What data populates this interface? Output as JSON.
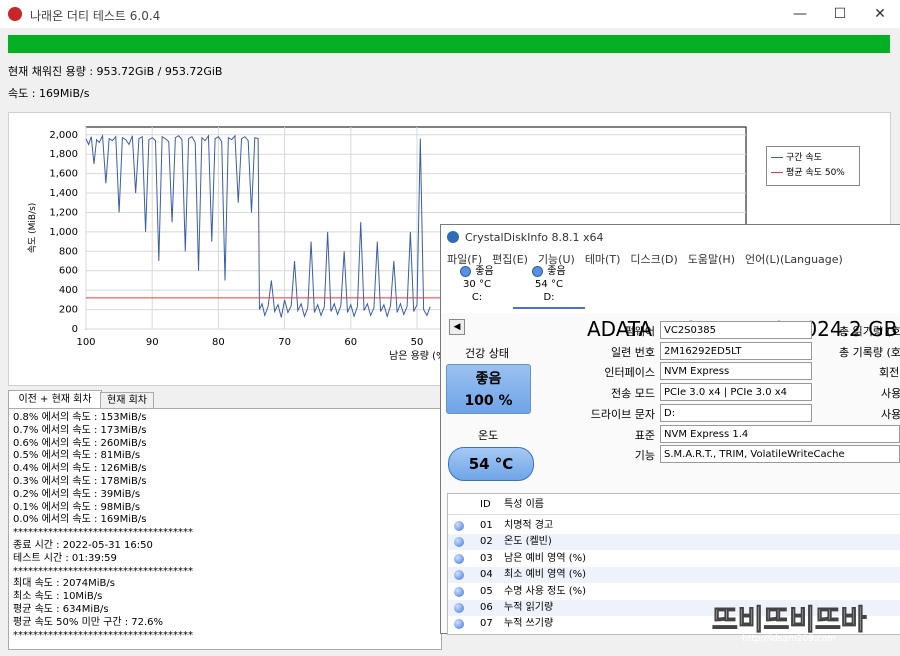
{
  "window": {
    "title": "나래온 더티 테스트 6.0.4",
    "min": "—",
    "max": "☐",
    "close": "✕"
  },
  "status": {
    "fill_label": "현재 채워진 용량 : 953.72GiB / 953.72GiB",
    "speed_label": "속도 : 169MiB/s",
    "progress": 1.0,
    "progress_color": "#06b025"
  },
  "chart_data": {
    "type": "line",
    "ylabel": "속도 (MiB/s)",
    "xlabel": "남은 용량 (%",
    "y_ticks": [
      "2,000",
      "1,800",
      "1,600",
      "1,400",
      "1,200",
      "1,000",
      "800",
      "600",
      "400",
      "200",
      "0"
    ],
    "x_ticks": [
      "100",
      "90",
      "80",
      "70",
      "60",
      "50"
    ],
    "ylim": [
      0,
      2080
    ],
    "xlim": [
      100,
      0
    ],
    "legend": {
      "series": "구간 속도",
      "average": "평균 속도 50%"
    },
    "average_value": 320,
    "series_color": "#3a5ea8",
    "average_color": "#e53b3b",
    "series": [
      {
        "x": 100,
        "y": 1960
      },
      {
        "x": 99.6,
        "y": 1900
      },
      {
        "x": 99.2,
        "y": 1980
      },
      {
        "x": 98.8,
        "y": 1700
      },
      {
        "x": 98.4,
        "y": 1950
      },
      {
        "x": 98,
        "y": 1920
      },
      {
        "x": 97.5,
        "y": 1990
      },
      {
        "x": 97,
        "y": 1500
      },
      {
        "x": 96.5,
        "y": 1960
      },
      {
        "x": 96,
        "y": 1940
      },
      {
        "x": 95.5,
        "y": 1980
      },
      {
        "x": 95,
        "y": 1200
      },
      {
        "x": 94.5,
        "y": 1970
      },
      {
        "x": 94,
        "y": 1950
      },
      {
        "x": 93.5,
        "y": 1900
      },
      {
        "x": 93,
        "y": 1990
      },
      {
        "x": 92.5,
        "y": 1400
      },
      {
        "x": 92,
        "y": 1960
      },
      {
        "x": 91.5,
        "y": 1980
      },
      {
        "x": 91,
        "y": 1000
      },
      {
        "x": 90.5,
        "y": 1950
      },
      {
        "x": 90,
        "y": 1970
      },
      {
        "x": 89.5,
        "y": 1940
      },
      {
        "x": 89,
        "y": 700
      },
      {
        "x": 88.5,
        "y": 1980
      },
      {
        "x": 88,
        "y": 1960
      },
      {
        "x": 87.5,
        "y": 1930
      },
      {
        "x": 87,
        "y": 1100
      },
      {
        "x": 86.5,
        "y": 1970
      },
      {
        "x": 86,
        "y": 1990
      },
      {
        "x": 85.5,
        "y": 1950
      },
      {
        "x": 85,
        "y": 800
      },
      {
        "x": 84.5,
        "y": 1960
      },
      {
        "x": 84,
        "y": 1980
      },
      {
        "x": 83.5,
        "y": 1920
      },
      {
        "x": 83,
        "y": 600
      },
      {
        "x": 82.5,
        "y": 1970
      },
      {
        "x": 82,
        "y": 1940
      },
      {
        "x": 81.5,
        "y": 1990
      },
      {
        "x": 81,
        "y": 900
      },
      {
        "x": 80.5,
        "y": 1960
      },
      {
        "x": 80,
        "y": 1980
      },
      {
        "x": 79.5,
        "y": 1930
      },
      {
        "x": 79,
        "y": 500
      },
      {
        "x": 78.5,
        "y": 1970
      },
      {
        "x": 78,
        "y": 1950
      },
      {
        "x": 77.5,
        "y": 1990
      },
      {
        "x": 77,
        "y": 1300
      },
      {
        "x": 76.5,
        "y": 1960
      },
      {
        "x": 76,
        "y": 1980
      },
      {
        "x": 75.5,
        "y": 1940
      },
      {
        "x": 75,
        "y": 1200
      },
      {
        "x": 74.5,
        "y": 1970
      },
      {
        "x": 74,
        "y": 1960
      },
      {
        "x": 73.8,
        "y": 200
      },
      {
        "x": 73.4,
        "y": 260
      },
      {
        "x": 73,
        "y": 140
      },
      {
        "x": 72.5,
        "y": 230
      },
      {
        "x": 72,
        "y": 500
      },
      {
        "x": 71.5,
        "y": 180
      },
      {
        "x": 71,
        "y": 250
      },
      {
        "x": 70.5,
        "y": 120
      },
      {
        "x": 70,
        "y": 300
      },
      {
        "x": 69.5,
        "y": 170
      },
      {
        "x": 69,
        "y": 240
      },
      {
        "x": 68.5,
        "y": 700
      },
      {
        "x": 68,
        "y": 190
      },
      {
        "x": 67.5,
        "y": 260
      },
      {
        "x": 67,
        "y": 130
      },
      {
        "x": 66.5,
        "y": 220
      },
      {
        "x": 66,
        "y": 900
      },
      {
        "x": 65.5,
        "y": 170
      },
      {
        "x": 65,
        "y": 250
      },
      {
        "x": 64.5,
        "y": 140
      },
      {
        "x": 64,
        "y": 230
      },
      {
        "x": 63.5,
        "y": 1000
      },
      {
        "x": 63,
        "y": 180
      },
      {
        "x": 62.5,
        "y": 260
      },
      {
        "x": 62,
        "y": 150
      },
      {
        "x": 61.5,
        "y": 240
      },
      {
        "x": 61,
        "y": 800
      },
      {
        "x": 60.5,
        "y": 170
      },
      {
        "x": 60,
        "y": 250
      },
      {
        "x": 59.5,
        "y": 130
      },
      {
        "x": 59,
        "y": 230
      },
      {
        "x": 58.5,
        "y": 1100
      },
      {
        "x": 58,
        "y": 190
      },
      {
        "x": 57.5,
        "y": 260
      },
      {
        "x": 57,
        "y": 140
      },
      {
        "x": 56.5,
        "y": 220
      },
      {
        "x": 56,
        "y": 900
      },
      {
        "x": 55.5,
        "y": 180
      },
      {
        "x": 55,
        "y": 250
      },
      {
        "x": 54.5,
        "y": 130
      },
      {
        "x": 54,
        "y": 240
      },
      {
        "x": 53.5,
        "y": 700
      },
      {
        "x": 53,
        "y": 170
      },
      {
        "x": 52.5,
        "y": 260
      },
      {
        "x": 52,
        "y": 150
      },
      {
        "x": 51.5,
        "y": 230
      },
      {
        "x": 51,
        "y": 1000
      },
      {
        "x": 50.5,
        "y": 180
      },
      {
        "x": 50,
        "y": 250
      },
      {
        "x": 49.5,
        "y": 1960
      },
      {
        "x": 49,
        "y": 200
      },
      {
        "x": 48.5,
        "y": 140
      },
      {
        "x": 48,
        "y": 230
      }
    ]
  },
  "tabs": {
    "active": "이전 + 현재 회차",
    "inactive": "현재 회차"
  },
  "log_lines": [
    "0.8% 에서의 속도 : 153MiB/s",
    "0.7% 에서의 속도 : 173MiB/s",
    "0.6% 에서의 속도 : 260MiB/s",
    "0.5% 에서의 속도 : 81MiB/s",
    "0.4% 에서의 속도 : 126MiB/s",
    "0.3% 에서의 속도 : 178MiB/s",
    "0.2% 에서의 속도 : 39MiB/s",
    "0.1% 에서의 속도 : 98MiB/s",
    "0.0% 에서의 속도 : 169MiB/s",
    "************************************",
    "종료 시간 : 2022-05-31 16:50",
    "테스트 시간 : 01:39:59",
    "************************************",
    "최대 속도 : 2074MiB/s",
    "최소 속도 : 10MiB/s",
    "평균 속도 : 634MiB/s",
    "평균 속도 50% 미만 구간 : 72.6%",
    "************************************"
  ],
  "cdi": {
    "title": "CrystalDiskInfo 8.8.1 x64",
    "menu": [
      "파일(F)",
      "편집(E)",
      "기능(U)",
      "테마(T)",
      "디스크(D)",
      "도움말(H)",
      "언어(L)(Language)"
    ],
    "drives": [
      {
        "status": "좋음",
        "temp": "30 °C",
        "letter": "C:"
      },
      {
        "status": "좋음",
        "temp": "54 °C",
        "letter": "D:"
      }
    ],
    "back": "◀",
    "model": "ADATA LEGEND 710 1024.2 GB",
    "health_label": "건강 상태",
    "health_status": "좋음",
    "health_pct": "100 %",
    "temp_label": "온도",
    "temp_value": "54 °C",
    "fields": [
      {
        "label": "펌웨어",
        "value": "VC2S0385"
      },
      {
        "label": "일련 번호",
        "value": "2M16292ED5LT"
      },
      {
        "label": "인터페이스",
        "value": "NVM Express"
      },
      {
        "label": "전송 모드",
        "value": "PCIe 3.0 x4 | PCIe 3.0 x4"
      },
      {
        "label": "드라이브 문자",
        "value": "D:"
      },
      {
        "label": "표준",
        "value": "NVM Express 1.4"
      },
      {
        "label": "기능",
        "value": "S.M.A.R.T., TRIM, VolatileWriteCache"
      }
    ],
    "right_labels": [
      "총 읽기량 (호스",
      "총 기록량 (호스",
      "회전",
      "사용",
      "사용"
    ],
    "smart_header": {
      "id": "ID",
      "name": "특성 이름"
    },
    "smart_rows": [
      {
        "id": "01",
        "name": "치명적 경고"
      },
      {
        "id": "02",
        "name": "온도 (켈빈)"
      },
      {
        "id": "03",
        "name": "남은 예비 영역 (%)"
      },
      {
        "id": "04",
        "name": "최소 예비 영역 (%)"
      },
      {
        "id": "05",
        "name": "수명 사용 정도 (%)"
      },
      {
        "id": "06",
        "name": "누적 읽기량"
      },
      {
        "id": "07",
        "name": "누적 쓰기량"
      }
    ]
  },
  "watermark": {
    "logo": "뜨비뜨비뜨바",
    "url": "http://idsam209.com"
  }
}
